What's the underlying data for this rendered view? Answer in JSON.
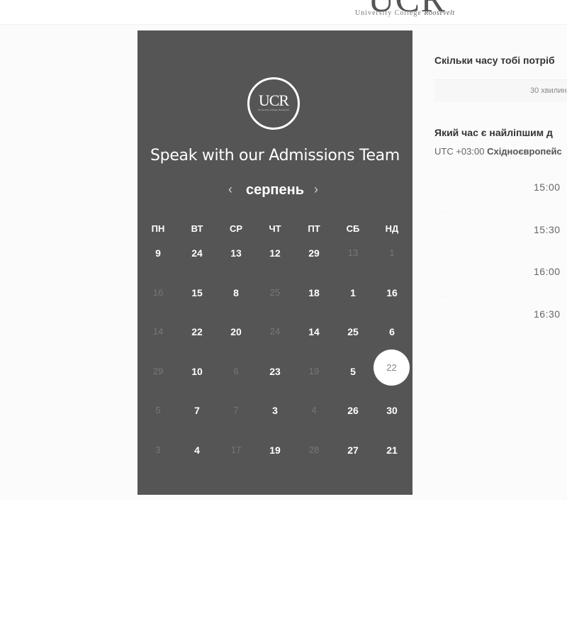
{
  "header": {
    "logo_text": "UCR",
    "logo_subtitle": "University College",
    "logo_script": "Roosevelt"
  },
  "calendar": {
    "logo_text": "UCR",
    "logo_subtext": "University College Roosevelt",
    "title": "Speak with our Admissions Team",
    "month": "серпень",
    "prev_icon": "‹",
    "next_icon": "›",
    "weekdays": [
      "ПН",
      "ВТ",
      "СР",
      "ЧТ",
      "ПТ",
      "СБ",
      "НД"
    ],
    "weeks": [
      [
        "9",
        "24",
        "13",
        "12",
        "29",
        "13",
        "1"
      ],
      [
        "16",
        "15",
        "8",
        "25",
        "18",
        "1",
        "16"
      ],
      [
        "14",
        "22",
        "20",
        "24",
        "14",
        "25",
        "6"
      ],
      [
        "29",
        "10",
        "6",
        "23",
        "19",
        "5",
        "22"
      ],
      [
        "5",
        "7",
        "7",
        "3",
        "4",
        "26",
        "30"
      ],
      [
        "3",
        "4",
        "17",
        "19",
        "28",
        "27",
        "21"
      ]
    ],
    "dim": [
      [
        false,
        false,
        false,
        false,
        false,
        true,
        true
      ],
      [
        true,
        false,
        false,
        true,
        false,
        false,
        false
      ],
      [
        true,
        false,
        false,
        true,
        false,
        false,
        false
      ],
      [
        true,
        false,
        true,
        false,
        true,
        false,
        false
      ],
      [
        true,
        false,
        true,
        false,
        true,
        false,
        false
      ],
      [
        true,
        false,
        true,
        false,
        true,
        false,
        false
      ]
    ],
    "selected": {
      "week": 3,
      "day": 6
    }
  },
  "booking": {
    "duration_question": "Скільки часу тобі потріб",
    "duration_value": "30 хвилин",
    "time_question": "Який час є найліпшим д",
    "timezone_offset": "UTC +03:00",
    "timezone_name": "Східноєвропейс",
    "slots": [
      "15:00",
      "15:30",
      "16:00",
      "16:30"
    ]
  },
  "colors": {
    "panel": "#555555",
    "page": "#ffffff",
    "band": "#fbfbfb",
    "selected_day_bg": "#ffffff"
  }
}
